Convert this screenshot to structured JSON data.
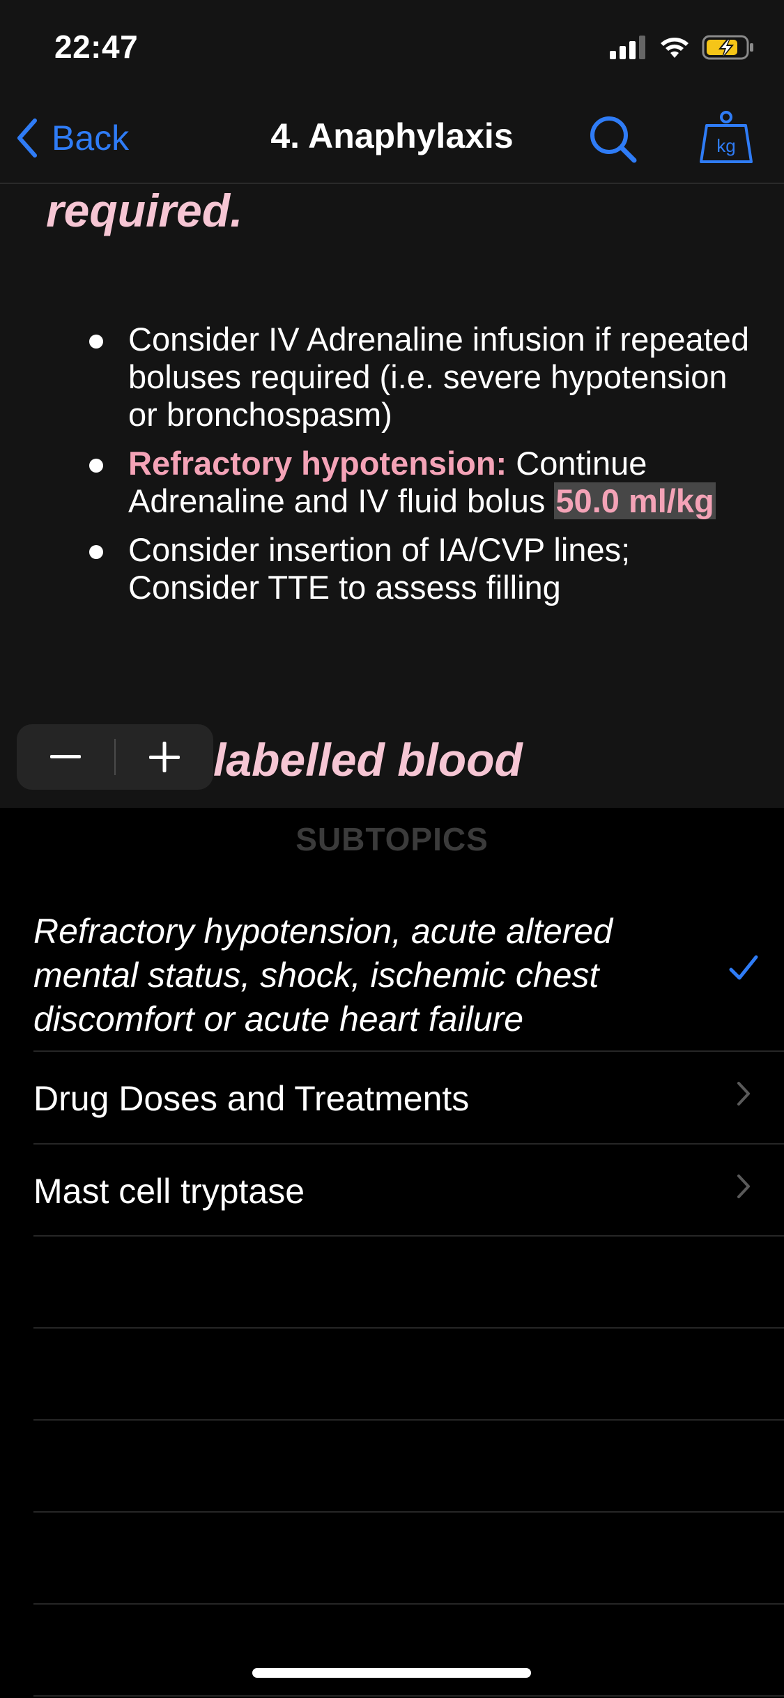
{
  "status_bar": {
    "time": "22:47"
  },
  "nav": {
    "back_label": "Back",
    "title": "4. Anaphylaxis",
    "kg_label": "kg"
  },
  "content": {
    "heading_top": "required.",
    "bullets": [
      {
        "text": "Consider IV Adrenaline infusion if repeated boluses required (i.e. severe hypotension or bronchospasm)"
      },
      {
        "bold_prefix": "Refractory hypotension:",
        "text_before_dose": " Continue Adrenaline and IV fluid bolus ",
        "dose": "50.0 ml/kg"
      },
      {
        "text": "Consider insertion of IA/CVP lines; Consider TTE to assess filling"
      }
    ],
    "heading_partial": "labelled blood"
  },
  "subtopics": {
    "header": "SUBTOPICS",
    "items": [
      {
        "label": "Refractory hypotension, acute altered mental status, shock, ischemic chest discomfort or acute heart failure",
        "selected": true
      },
      {
        "label": "Drug Doses and Treatments",
        "selected": false
      },
      {
        "label": "Mast cell tryptase",
        "selected": false
      }
    ]
  },
  "colors": {
    "accent": "#2f7cf6",
    "pink": "#f4a3b7",
    "heading_pink": "#f6c6d4",
    "battery": "#f5c518"
  }
}
